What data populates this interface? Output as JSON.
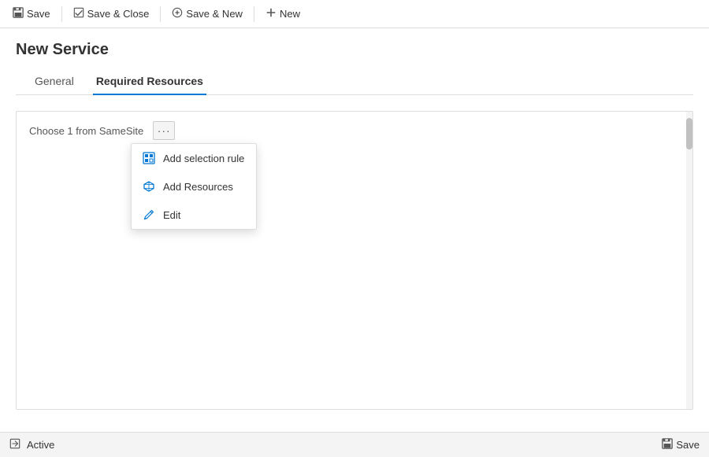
{
  "toolbar": {
    "save_label": "Save",
    "save_close_label": "Save & Close",
    "save_new_label": "Save & New",
    "new_label": "New"
  },
  "page": {
    "title": "New Service"
  },
  "tabs": [
    {
      "id": "general",
      "label": "General",
      "active": false
    },
    {
      "id": "required-resources",
      "label": "Required Resources",
      "active": true
    }
  ],
  "resource_section": {
    "label": "Choose 1 from SameSite",
    "ellipsis_label": "···"
  },
  "dropdown_menu": {
    "items": [
      {
        "id": "add-selection-rule",
        "label": "Add selection rule",
        "icon": "⊞"
      },
      {
        "id": "add-resources",
        "label": "Add Resources",
        "icon": "⬡"
      },
      {
        "id": "edit",
        "label": "Edit",
        "icon": "✏"
      }
    ]
  },
  "status_bar": {
    "icon": "⬡",
    "label": "Active",
    "save_label": "Save"
  }
}
